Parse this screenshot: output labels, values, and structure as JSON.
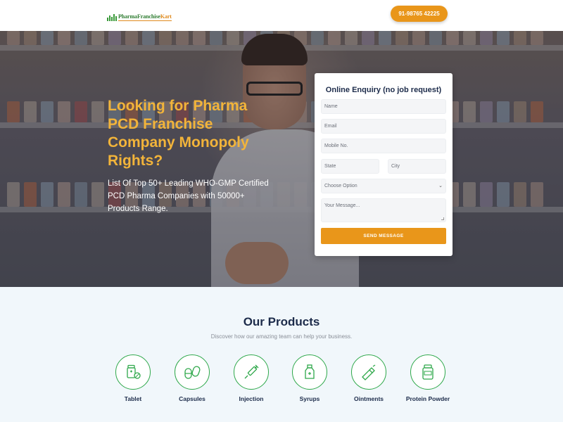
{
  "header": {
    "logo_text_a": "PharmaFranchise",
    "logo_text_b": "Kart",
    "phone_label": "91-98765 42225"
  },
  "hero": {
    "title": "Looking for Pharma PCD Franchise Company Monopoly Rights?",
    "subtitle": "List Of Top 50+ Leading WHO-GMP Certified PCD Pharma Companies with 50000+ Products Range."
  },
  "form": {
    "title": "Online Enquiry (no job request)",
    "name_placeholder": "Name",
    "email_placeholder": "Email",
    "mobile_placeholder": "Mobile No.",
    "state_placeholder": "State",
    "city_placeholder": "City",
    "select_value": "Choose Option",
    "message_placeholder": "Your Message...",
    "submit_label": "SEND MESSAGE"
  },
  "products": {
    "title": "Our Products",
    "subtitle": "Discover how our amazing team can help your business.",
    "items": [
      {
        "label": "Tablet",
        "icon": "tablet-icon"
      },
      {
        "label": "Capsules",
        "icon": "capsules-icon"
      },
      {
        "label": "Injection",
        "icon": "syringe-icon"
      },
      {
        "label": "Syrups",
        "icon": "syrup-bottle-icon"
      },
      {
        "label": "Ointments",
        "icon": "ointment-tube-icon"
      },
      {
        "label": "Protein Powder",
        "icon": "protein-jar-icon"
      }
    ]
  },
  "colors": {
    "accent": "#e9961a",
    "headline": "#f2b43a",
    "navy": "#1c2b4a",
    "green": "#2ea84a"
  }
}
